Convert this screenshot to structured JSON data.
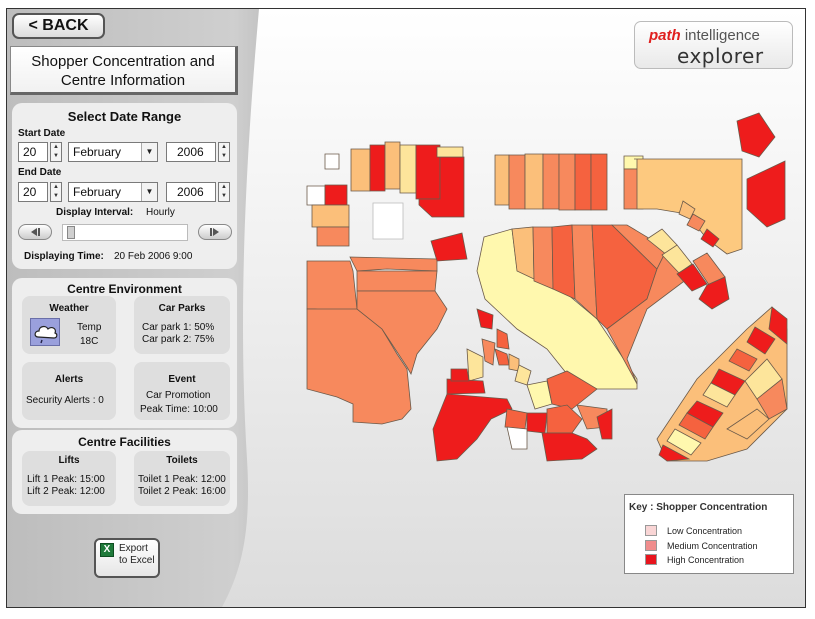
{
  "back_button": "< BACK",
  "page_title_line1": "Shopper Concentration and",
  "page_title_line2": "Centre Information",
  "date_range": {
    "title": "Select Date Range",
    "start_label": "Start Date",
    "start_day": "20",
    "start_month": "February",
    "start_year": "2006",
    "end_label": "End Date",
    "end_day": "20",
    "end_month": "February",
    "end_year": "2006",
    "interval_label": "Display Interval:",
    "interval_value": "Hourly",
    "displaying_label": "Displaying Time:",
    "displaying_value": "20 Feb 2006   9:00",
    "slider_position": 0.0
  },
  "environment": {
    "title": "Centre Environment",
    "weather_title": "Weather",
    "temp_label": "Temp",
    "temp_value": "18C",
    "carparks_title": "Car Parks",
    "carpark1": "Car park 1:  50%",
    "carpark2": "Car park 2:  75%",
    "alerts_title": "Alerts",
    "alerts_text": "Security Alerts :  0",
    "event_title": "Event",
    "event_text": "Car Promotion",
    "event_peak": "Peak Time:  10:00"
  },
  "facilities": {
    "title": "Centre Facilities",
    "lifts_title": "Lifts",
    "lift1": "Lift 1 Peak:  15:00",
    "lift2": "Lift 2 Peak:  12:00",
    "toilets_title": "Toilets",
    "toilet1": "Toilet 1 Peak:  12:00",
    "toilet2": "Toilet 2 Peak:  16:00"
  },
  "export": {
    "line1": "Export",
    "line2": "to Excel"
  },
  "logo": {
    "brand_bold": "path",
    "brand_rest": " intelligence",
    "product": "explorer"
  },
  "key": {
    "title": "Key : Shopper Concentration",
    "low": "Low Concentration",
    "medium": "Medium Concentration",
    "high": "High Concentration",
    "low_color": "#f9d5d5",
    "medium_color": "#f08d8d",
    "high_color": "#e8141d"
  },
  "colors": {
    "high": "#ee1c1c",
    "medhigh": "#f5623f",
    "medium": "#f7895d",
    "lowmed": "#fbbf7a",
    "low": "#fde59b",
    "vlow": "#fff8ae"
  },
  "icons": {
    "weather": "rain-cloud-icon",
    "excel": "excel-icon"
  }
}
